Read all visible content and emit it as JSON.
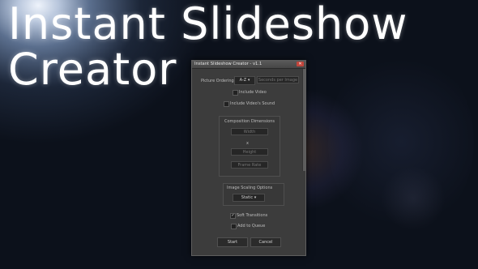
{
  "hero": {
    "line1": "Instant Slideshow",
    "line2": "Creator"
  },
  "dialog": {
    "title": "Instant Slideshow Creator - v1.1",
    "close_glyph": "✕",
    "picture_ordering": {
      "label": "Picture Ordering",
      "value": "A-Z",
      "caret": "▾",
      "seconds_placeholder": "Seconds per Image"
    },
    "include_video": {
      "label": "Include Video",
      "checked": false
    },
    "include_video_sound": {
      "label": "Include Video's Sound",
      "checked": false
    },
    "composition": {
      "heading": "Composition Dimensions",
      "width_placeholder": "Width",
      "times": "x",
      "height_placeholder": "Height",
      "frame_rate_placeholder": "Frame Rate"
    },
    "scaling": {
      "heading": "Image Scaling Options",
      "value": "Static",
      "caret": "▾"
    },
    "soft_transitions": {
      "label": "Soft Transitions",
      "checked": true,
      "check_glyph": "✓"
    },
    "add_to_queue": {
      "label": "Add to Queue",
      "checked": false
    },
    "start_label": "Start",
    "cancel_label": "Cancel"
  },
  "colors": {
    "accent_close": "#c1453c",
    "dialog_bg": "#3c3c3c",
    "background": "#0c111b"
  }
}
